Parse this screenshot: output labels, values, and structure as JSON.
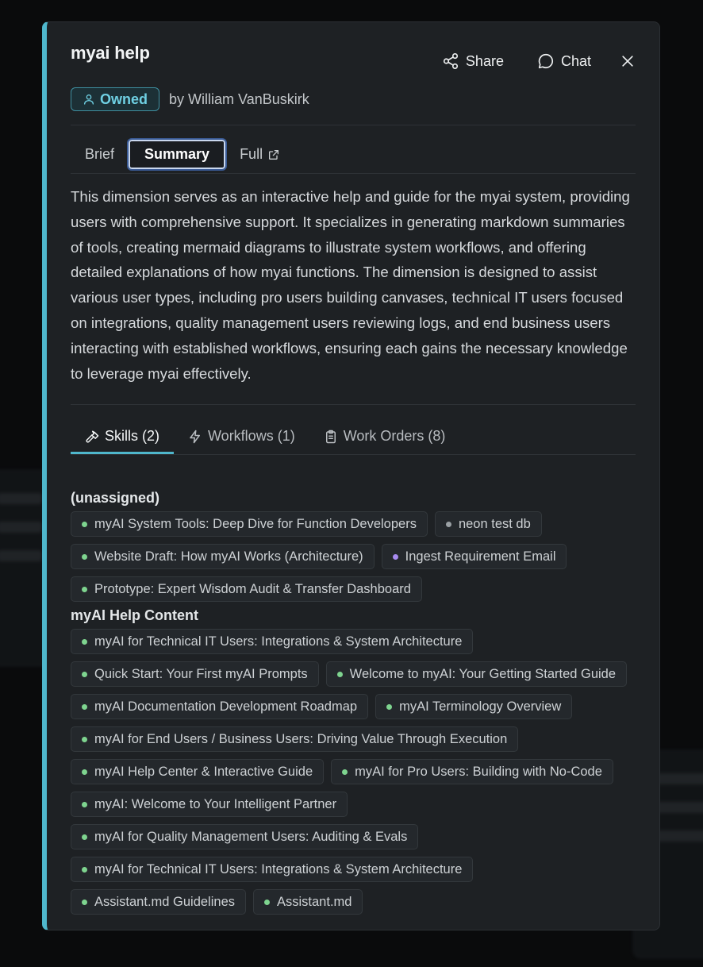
{
  "header": {
    "title": "myai help",
    "share_label": "Share",
    "chat_label": "Chat"
  },
  "owner": {
    "badge": "Owned",
    "by": "by William VanBuskirk"
  },
  "view_tabs": [
    "Brief",
    "Summary",
    "Full"
  ],
  "summary": "This dimension serves as an interactive help and guide for the myai system, providing users with comprehensive support. It specializes in generating markdown summaries of tools, creating mermaid diagrams to illustrate system workflows, and offering detailed explanations of how myai functions. The dimension is designed to assist various user types, including pro users building canvases, technical IT users focused on integrations, quality management users reviewing logs, and end business users interacting with established workflows, ensuring each gains the necessary knowledge to leverage myai effectively.",
  "section_tabs": [
    "Skills (2)",
    "Workflows (1)",
    "Work Orders (8)"
  ],
  "groups": [
    {
      "title": "(unassigned)",
      "items": [
        {
          "label": "myAI System Tools: Deep Dive for Function Developers",
          "color": "#7ed48f"
        },
        {
          "label": "neon test db",
          "color": "#9aa0a4"
        },
        {
          "label": "Website Draft: How myAI Works (Architecture)",
          "color": "#7ed48f"
        },
        {
          "label": "Ingest Requirement Email",
          "color": "#a78bf0"
        },
        {
          "label": "Prototype: Expert Wisdom Audit & Transfer Dashboard",
          "color": "#7ed48f"
        }
      ]
    },
    {
      "title": "myAI Help Content",
      "items": [
        {
          "label": "myAI for Technical IT Users: Integrations & System Architecture",
          "color": "#7ed48f"
        },
        {
          "label": "Quick Start: Your First myAI Prompts",
          "color": "#7ed48f"
        },
        {
          "label": "Welcome to myAI: Your Getting Started Guide",
          "color": "#7ed48f"
        },
        {
          "label": "myAI Documentation Development Roadmap",
          "color": "#7ed48f"
        },
        {
          "label": "myAI Terminology Overview",
          "color": "#7ed48f"
        },
        {
          "label": "myAI for End Users / Business Users: Driving Value Through Execution",
          "color": "#7ed48f"
        },
        {
          "label": "myAI Help Center & Interactive Guide",
          "color": "#7ed48f"
        },
        {
          "label": "myAI for Pro Users: Building with No-Code",
          "color": "#7ed48f"
        },
        {
          "label": "myAI: Welcome to Your Intelligent Partner",
          "color": "#7ed48f"
        },
        {
          "label": "myAI for Quality Management Users: Auditing & Evals",
          "color": "#7ed48f"
        },
        {
          "label": "myAI for Technical IT Users: Integrations & System Architecture",
          "color": "#7ed48f"
        },
        {
          "label": "Assistant.md Guidelines",
          "color": "#7ed48f"
        },
        {
          "label": "Assistant.md",
          "color": "#7ed48f"
        }
      ]
    }
  ]
}
